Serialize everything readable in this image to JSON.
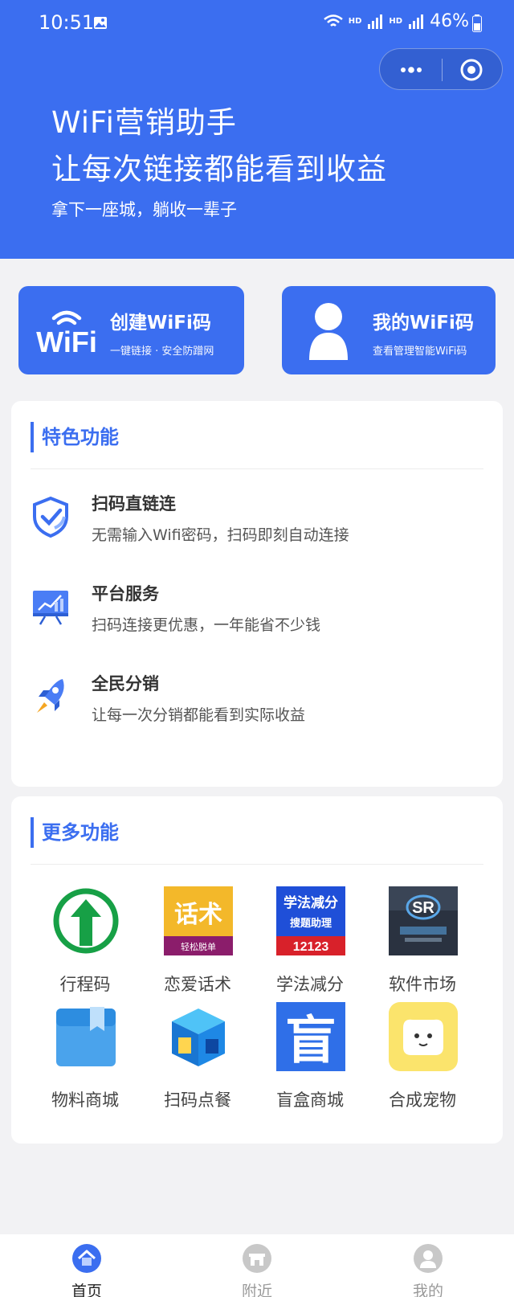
{
  "status_bar": {
    "time": "10:51",
    "hd1": "HD",
    "hd2": "HD",
    "battery": "46%"
  },
  "hero": {
    "title_line1": "WiFi营销助手",
    "title_line2": "让每次链接都能看到收益",
    "subtitle": "拿下一座城，躺收一辈子"
  },
  "actions": {
    "create": {
      "title": "创建WiFi码",
      "subtitle": "一键链接 · 安全防蹭网",
      "logo_text": "WiFi"
    },
    "mine": {
      "title": "我的WiFi码",
      "subtitle": "查看管理智能WiFi码"
    }
  },
  "features": {
    "heading": "特色功能",
    "items": [
      {
        "title": "扫码直链连",
        "desc": "无需输入Wifi密码，扫码即刻自动连接",
        "icon": "shield-check-icon"
      },
      {
        "title": "平台服务",
        "desc": "扫码连接更优惠，一年能省不少钱",
        "icon": "chart-board-icon"
      },
      {
        "title": "全民分销",
        "desc": "让每一次分销都能看到实际收益",
        "icon": "rocket-icon"
      }
    ]
  },
  "more": {
    "heading": "更多功能",
    "items": [
      {
        "label": "行程码",
        "icon": "up-arrow-circle-icon"
      },
      {
        "label": "恋爱话术",
        "icon": "love-talk-icon",
        "icon_text": "话术",
        "icon_subtext": "轻松脱单"
      },
      {
        "label": "学法减分",
        "icon": "traffic-law-icon",
        "icon_text": "学法减分",
        "icon_subtext": "搜题助理",
        "icon_number": "12123"
      },
      {
        "label": "软件市场",
        "icon": "software-market-icon",
        "icon_text": "SR"
      },
      {
        "label": "物料商城",
        "icon": "box-icon"
      },
      {
        "label": "扫码点餐",
        "icon": "store-icon"
      },
      {
        "label": "盲盒商城",
        "icon": "blind-box-icon",
        "icon_text": "盲"
      },
      {
        "label": "合成宠物",
        "icon": "pet-icon"
      }
    ]
  },
  "tabbar": {
    "home": "首页",
    "nearby": "附近",
    "mine": "我的"
  },
  "colors": {
    "primary": "#3b6ef0",
    "background": "#f2f2f4"
  }
}
